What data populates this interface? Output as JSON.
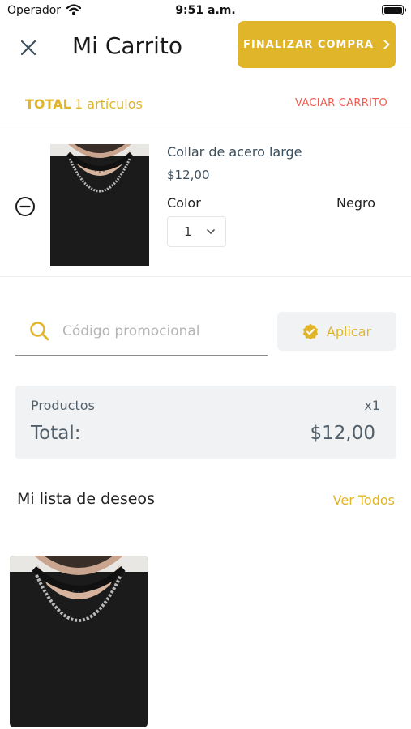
{
  "status_bar": {
    "carrier": "Operador",
    "time": "9:51 a.m."
  },
  "header": {
    "title": "Mi Carrito",
    "checkout_label": "FINALIZAR COMPRA",
    "close_icon": "close-icon",
    "arrow_icon": "chevron-right-icon"
  },
  "summary": {
    "total_label": "TOTAL",
    "item_count": "1 artículos",
    "empty_cart_label": "VACIAR CARRITO"
  },
  "cart_items": [
    {
      "name": "Collar de acero large",
      "price": "$12,00",
      "color_label": "Color",
      "color_value": "Negro",
      "quantity": "1"
    }
  ],
  "promo": {
    "placeholder": "Código promocional",
    "value": "",
    "apply_label": "Aplicar"
  },
  "totals": {
    "products_label": "Productos",
    "products_qty": "x1",
    "total_label": "Total:",
    "total_value": "$12,00"
  },
  "wishlist": {
    "title": "Mi lista de deseos",
    "see_all_label": "Ver Todos"
  },
  "colors": {
    "accent": "#e0b52a",
    "danger": "#f05a4e",
    "muted_panel": "#f1f2f4",
    "text_secondary": "#52606b"
  }
}
